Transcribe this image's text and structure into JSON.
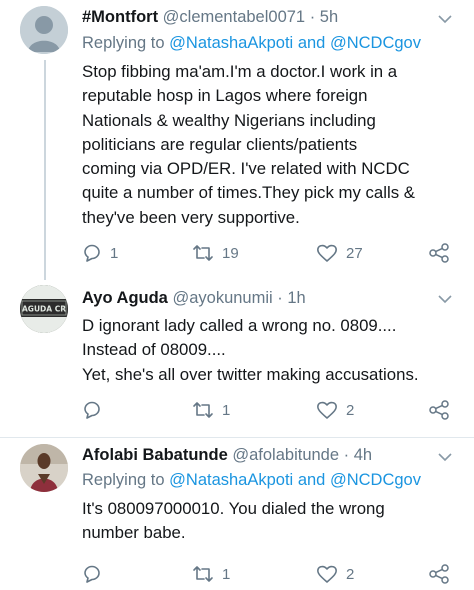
{
  "tweets": [
    {
      "name": "#Montfort",
      "handle": "@clementabel0071",
      "time": "5h",
      "replying_prefix": "Replying to",
      "replying_to_1": "@NatashaAkpoti",
      "replying_and": "and",
      "replying_to_2": "@NCDCgov",
      "body_lines": [
        "Stop fibbing ma'am.I'm a doctor.I work in a",
        "reputable hosp in Lagos where foreign",
        "Nationals & wealthy Nigerians including",
        "politicians are regular clients/patients",
        "coming via OPD/ER. I've related with NCDC",
        "quite a number of times.They pick my calls &",
        "they've been very supportive."
      ],
      "replies": "1",
      "retweets": "19",
      "likes": "27",
      "avatar": "default-avatar"
    },
    {
      "name": "Ayo Aguda",
      "handle": "@ayokunumii",
      "time": "1h",
      "avatar_text": "AGUDA CR",
      "body_lines": [
        "D ignorant lady called a wrong no. 0809....",
        "Instead of 08009....",
        "Yet, she's all over twitter making accusations."
      ],
      "replies": "",
      "retweets": "1",
      "likes": "2"
    },
    {
      "name": "Afolabi Babatunde",
      "handle": "@afolabitunde",
      "time": "4h",
      "replying_prefix": "Replying to",
      "replying_to_1": "@NatashaAkpoti",
      "replying_and": "and",
      "replying_to_2": "@NCDCgov",
      "body_lines": [
        "It's 080097000010. You dialed the wrong",
        "number babe."
      ],
      "replies": "",
      "retweets": "1",
      "likes": "2"
    }
  ],
  "separator": "·",
  "colors": {
    "text": "#14171a",
    "secondary": "#657786",
    "link": "#1b95e0",
    "divider": "#e1e8ed"
  }
}
